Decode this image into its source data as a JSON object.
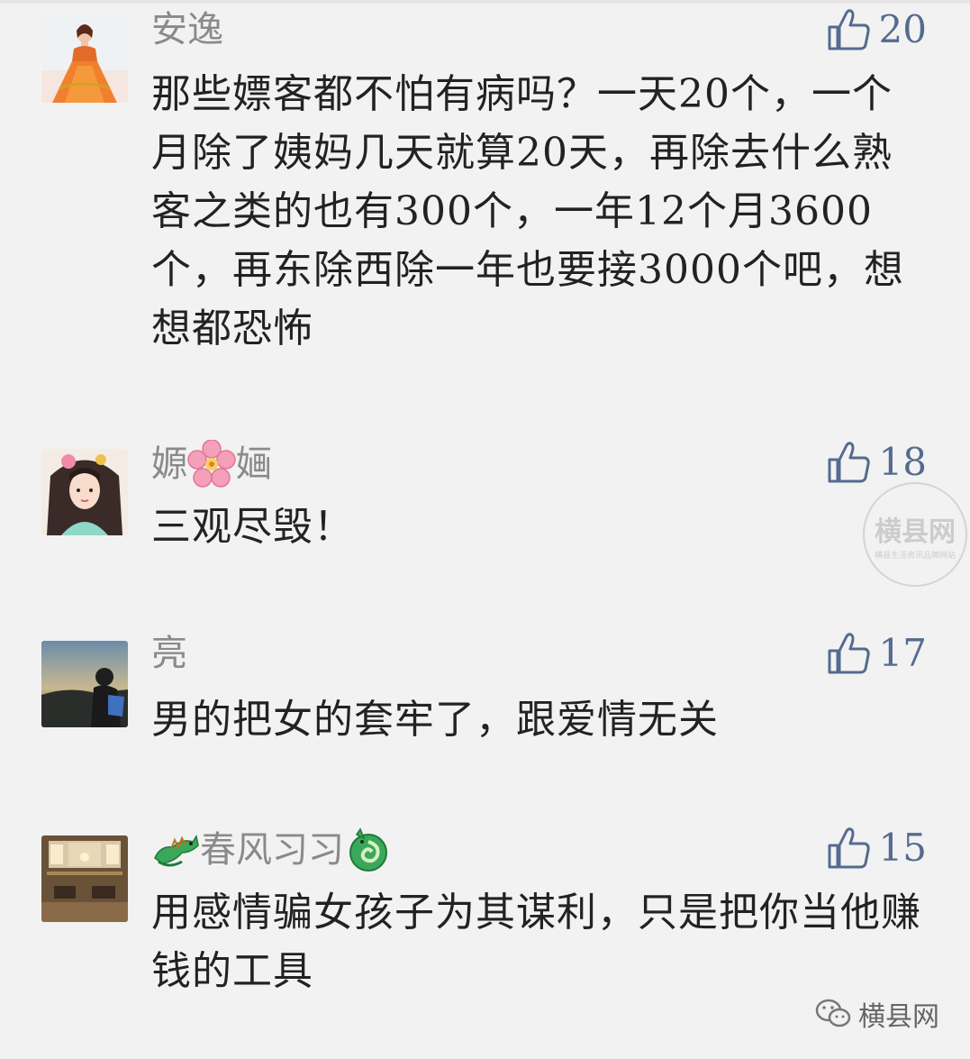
{
  "comments": [
    {
      "username": "安逸",
      "likes": "20",
      "text": "那些嫖客都不怕有病吗？一天20个，一个月除了姨妈几天就算20天，再除去什么熟客之类的也有300个，一年12个月3600个，再东除西除一年也要接3000个吧，想想都恐怖",
      "avatar": "doll-in-orange-dress"
    },
    {
      "username_before": "嫄",
      "username_after": "婳",
      "username_emoji": "cherry-blossom-icon",
      "likes": "18",
      "text": "三观尽毁！",
      "avatar": "ancient-costume-girl-illustration"
    },
    {
      "username": "亮",
      "likes": "17",
      "text": "男的把女的套牢了，跟爱情无关",
      "avatar": "person-at-sunset-coast"
    },
    {
      "username": "春风习习",
      "username_emoji_left": "green-dragon-icon",
      "username_emoji_right": "coiled-dragon-icon",
      "likes": "15",
      "text": "用感情骗女孩子为其谋利，只是把你当他赚钱的工具",
      "avatar": "luxury-interior-room"
    }
  ],
  "watermark": {
    "title": "横县网",
    "subtitle": "横县生活资讯品牌网站"
  },
  "footer": {
    "brand": "横县网",
    "icon": "wechat-icon"
  },
  "colors": {
    "like_blue": "#546b8f",
    "username_gray": "#8a8a8a",
    "text": "#222222",
    "background": "#f2f2f2"
  }
}
